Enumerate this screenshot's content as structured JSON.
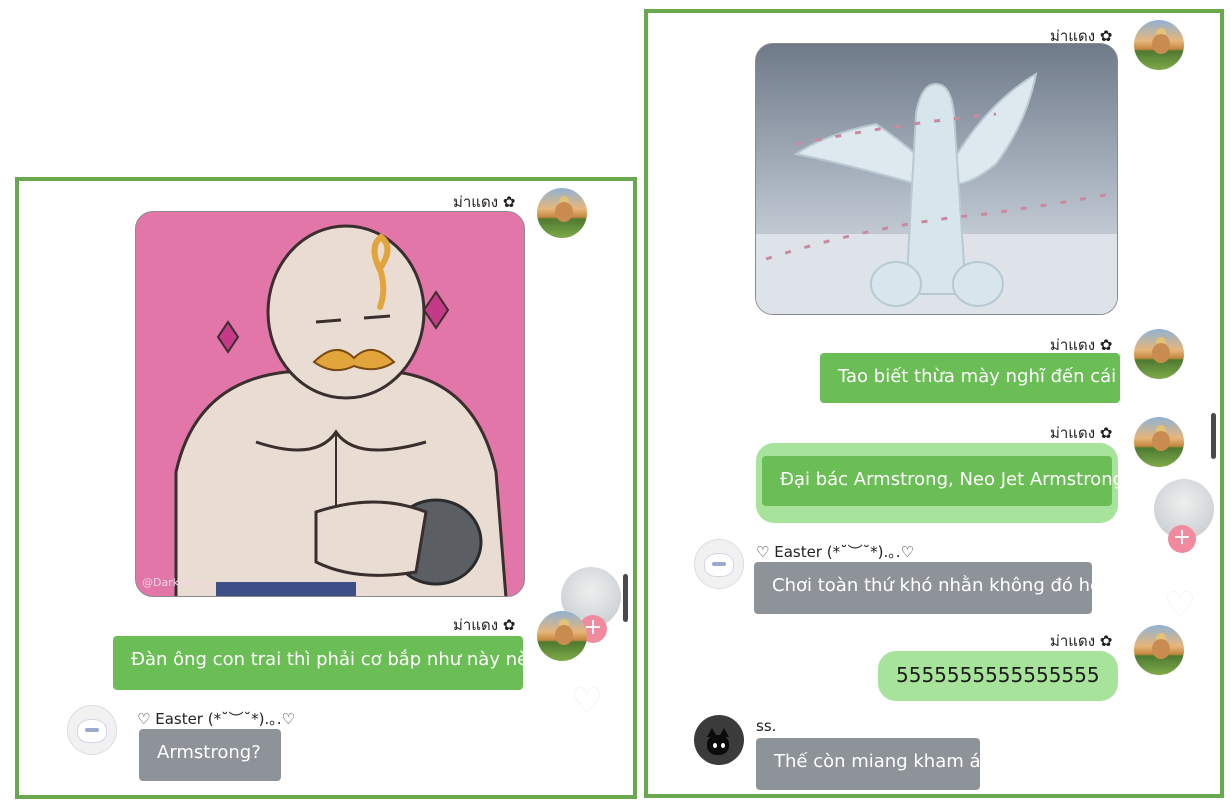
{
  "left_panel": {
    "header_name": "ม่าแดง ✿",
    "image_watermark": "@Darkness",
    "reply_name": "ม่าแดง ✿",
    "reply_text": "Đàn ông con trai thì phải cơ bắp như này nè",
    "other_name": "♡ Easter (*˘︶˘*).｡.♡",
    "other_text": "Armstrong?",
    "plus_label": "+"
  },
  "right_panel": {
    "header_name": "ม่าแดง ✿",
    "msg1_name": "ม่าแดง ✿",
    "msg1_text": "Tao biết thừa mày nghĩ đến cái gì",
    "msg2_name": "ม่าแดง ✿",
    "msg2_text": "Đại bác Armstrong, Neo Jet Armstrong",
    "easter_name": "♡ Easter (*˘︶˘*).｡.♡",
    "easter_text": "Chơi toàn thứ khó nhằn không đó hen?",
    "msg3_name": "ม่าแดง ✿",
    "msg3_text": "5555555555555555",
    "ss_name": "ss.",
    "ss_text": "Thế còn miang kham á?",
    "plus_label": "+"
  },
  "colors": {
    "frame_border": "#6aa84f",
    "bubble_green": "#6bbd55",
    "bubble_gray": "#8e9299",
    "bubble_pill": "#a7e39a",
    "image_pink": "#e276a8",
    "plus_badge": "#f08b9f"
  },
  "icons": [
    "flower-icon",
    "plus-icon",
    "heart-icon",
    "avatar-image"
  ]
}
